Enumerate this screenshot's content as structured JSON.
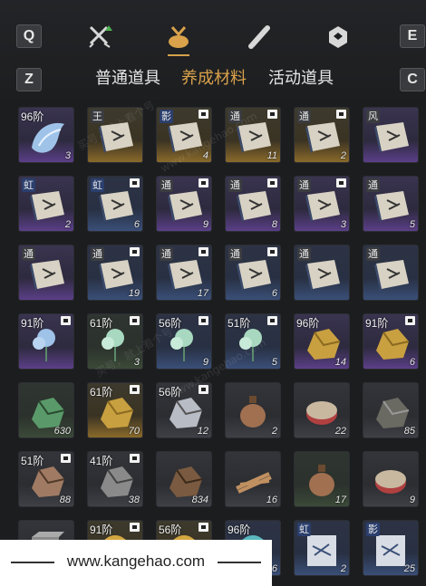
{
  "keys": {
    "q": "Q",
    "e": "E",
    "z": "Z",
    "c": "C"
  },
  "top_tabs": [
    {
      "icon": "crossed-swords-icon"
    },
    {
      "icon": "pouch-icon",
      "selected": true
    },
    {
      "icon": "scroll-icon"
    },
    {
      "icon": "gem-badge-icon"
    }
  ],
  "sub_tabs": [
    {
      "label": "普通道具",
      "active": false
    },
    {
      "label": "养成材料",
      "active": true
    },
    {
      "label": "活动道具",
      "active": false
    }
  ],
  "colors": {
    "accent": "#d9a24b",
    "purple": "#5b3f88",
    "gold": "#8a6a2a",
    "blue": "#3a4f78"
  },
  "items": [
    {
      "rarity": "purple",
      "tier": "96阶",
      "badge": false,
      "stamp": "",
      "icon": "crystal-wing-icon",
      "count": "3"
    },
    {
      "rarity": "gold",
      "tier": "",
      "badge": false,
      "stamp": "王",
      "icon": "manual-book-icon",
      "count": ""
    },
    {
      "rarity": "gold",
      "tier": "",
      "badge": true,
      "stamp": "影",
      "icon": "manual-book-icon",
      "count": "4"
    },
    {
      "rarity": "gold",
      "tier": "",
      "badge": true,
      "stamp": "通",
      "icon": "manual-book-icon",
      "count": "11"
    },
    {
      "rarity": "gold",
      "tier": "",
      "badge": true,
      "stamp": "通",
      "icon": "manual-book-icon",
      "count": "2"
    },
    {
      "rarity": "purple",
      "tier": "",
      "badge": false,
      "stamp": "风",
      "icon": "manual-book-icon",
      "count": ""
    },
    {
      "rarity": "purple",
      "tier": "",
      "badge": false,
      "stamp": "虹",
      "icon": "manual-book-icon",
      "count": "2"
    },
    {
      "rarity": "blue",
      "tier": "",
      "badge": true,
      "stamp": "虹",
      "icon": "manual-book-icon",
      "count": "6"
    },
    {
      "rarity": "purple",
      "tier": "",
      "badge": true,
      "stamp": "通",
      "icon": "manual-book-icon",
      "count": "9"
    },
    {
      "rarity": "purple",
      "tier": "",
      "badge": true,
      "stamp": "通",
      "icon": "manual-book-icon",
      "count": "8"
    },
    {
      "rarity": "purple",
      "tier": "",
      "badge": true,
      "stamp": "通",
      "icon": "manual-book-icon",
      "count": "3"
    },
    {
      "rarity": "purple",
      "tier": "",
      "badge": false,
      "stamp": "通",
      "icon": "manual-book-icon",
      "count": "5"
    },
    {
      "rarity": "purple",
      "tier": "",
      "badge": false,
      "stamp": "通",
      "icon": "manual-book-icon",
      "count": ""
    },
    {
      "rarity": "blue",
      "tier": "",
      "badge": true,
      "stamp": "通",
      "icon": "manual-book-icon",
      "count": "19"
    },
    {
      "rarity": "blue",
      "tier": "",
      "badge": true,
      "stamp": "通",
      "icon": "manual-book-icon",
      "count": "17"
    },
    {
      "rarity": "blue",
      "tier": "",
      "badge": true,
      "stamp": "通",
      "icon": "manual-book-icon",
      "count": "6"
    },
    {
      "rarity": "blue",
      "tier": "",
      "badge": false,
      "stamp": "通",
      "icon": "manual-book-icon",
      "count": ""
    },
    {
      "rarity": "blue",
      "tier": "",
      "badge": false,
      "stamp": "通",
      "icon": "manual-book-icon",
      "count": ""
    },
    {
      "rarity": "purple",
      "tier": "91阶",
      "badge": true,
      "stamp": "",
      "icon": "blue-flower-icon",
      "count": ""
    },
    {
      "rarity": "green",
      "tier": "61阶",
      "badge": true,
      "stamp": "",
      "icon": "jade-flower-icon",
      "count": "3"
    },
    {
      "rarity": "blue",
      "tier": "56阶",
      "badge": true,
      "stamp": "",
      "icon": "jade-flower-icon",
      "count": "9"
    },
    {
      "rarity": "blue",
      "tier": "51阶",
      "badge": true,
      "stamp": "",
      "icon": "jade-flower-icon",
      "count": "5"
    },
    {
      "rarity": "purple",
      "tier": "96阶",
      "badge": false,
      "stamp": "",
      "icon": "gold-ore-icon",
      "count": "14"
    },
    {
      "rarity": "purple",
      "tier": "91阶",
      "badge": true,
      "stamp": "",
      "icon": "gold-ore-icon",
      "count": "6"
    },
    {
      "rarity": "green",
      "tier": "",
      "badge": false,
      "stamp": "",
      "icon": "jade-ore-icon",
      "count": "630"
    },
    {
      "rarity": "gold",
      "tier": "61阶",
      "badge": true,
      "stamp": "",
      "icon": "gold-ore-icon",
      "count": "70"
    },
    {
      "rarity": "grey",
      "tier": "56阶",
      "badge": true,
      "stamp": "",
      "icon": "silver-ore-icon",
      "count": "12"
    },
    {
      "rarity": "grey",
      "tier": "",
      "badge": false,
      "stamp": "",
      "icon": "gourd-flask-icon",
      "count": "2"
    },
    {
      "rarity": "grey",
      "tier": "",
      "badge": false,
      "stamp": "",
      "icon": "seal-box-icon",
      "count": "22"
    },
    {
      "rarity": "grey",
      "tier": "",
      "badge": false,
      "stamp": "",
      "icon": "dark-ore-icon",
      "count": "85"
    },
    {
      "rarity": "grey",
      "tier": "51阶",
      "badge": true,
      "stamp": "",
      "icon": "copper-ore-icon",
      "count": "88"
    },
    {
      "rarity": "grey",
      "tier": "41阶",
      "badge": true,
      "stamp": "",
      "icon": "iron-ore-icon",
      "count": "38"
    },
    {
      "rarity": "grey",
      "tier": "",
      "badge": false,
      "stamp": "",
      "icon": "rust-ore-icon",
      "count": "834"
    },
    {
      "rarity": "grey",
      "tier": "",
      "badge": false,
      "stamp": "",
      "icon": "wood-bundle-icon",
      "count": "16"
    },
    {
      "rarity": "green",
      "tier": "",
      "badge": false,
      "stamp": "",
      "icon": "gourd-flask-icon",
      "count": "17"
    },
    {
      "rarity": "grey",
      "tier": "",
      "badge": false,
      "stamp": "",
      "icon": "seal-box-icon",
      "count": "9"
    },
    {
      "rarity": "grey",
      "tier": "",
      "badge": false,
      "stamp": "",
      "icon": "stone-block-icon",
      "count": ""
    },
    {
      "rarity": "gold",
      "tier": "91阶",
      "badge": true,
      "stamp": "",
      "icon": "gold-orb-icon",
      "count": ""
    },
    {
      "rarity": "gold",
      "tier": "56阶",
      "badge": true,
      "stamp": "",
      "icon": "gold-orb-icon",
      "count": ""
    },
    {
      "rarity": "blue",
      "tier": "96阶",
      "badge": false,
      "stamp": "",
      "icon": "teal-orb-icon",
      "count": "6"
    },
    {
      "rarity": "blue",
      "tier": "",
      "badge": false,
      "stamp": "虹",
      "icon": "letter-icon",
      "count": "2"
    },
    {
      "rarity": "blue",
      "tier": "",
      "badge": false,
      "stamp": "影",
      "icon": "letter-icon",
      "count": "25"
    }
  ],
  "footer": {
    "url": "www.kangehao.com"
  },
  "watermarks": [
    "买号，就上看个号",
    "www.kangehao.com",
    "买号，就上看个号",
    "www.kangehao.com"
  ]
}
